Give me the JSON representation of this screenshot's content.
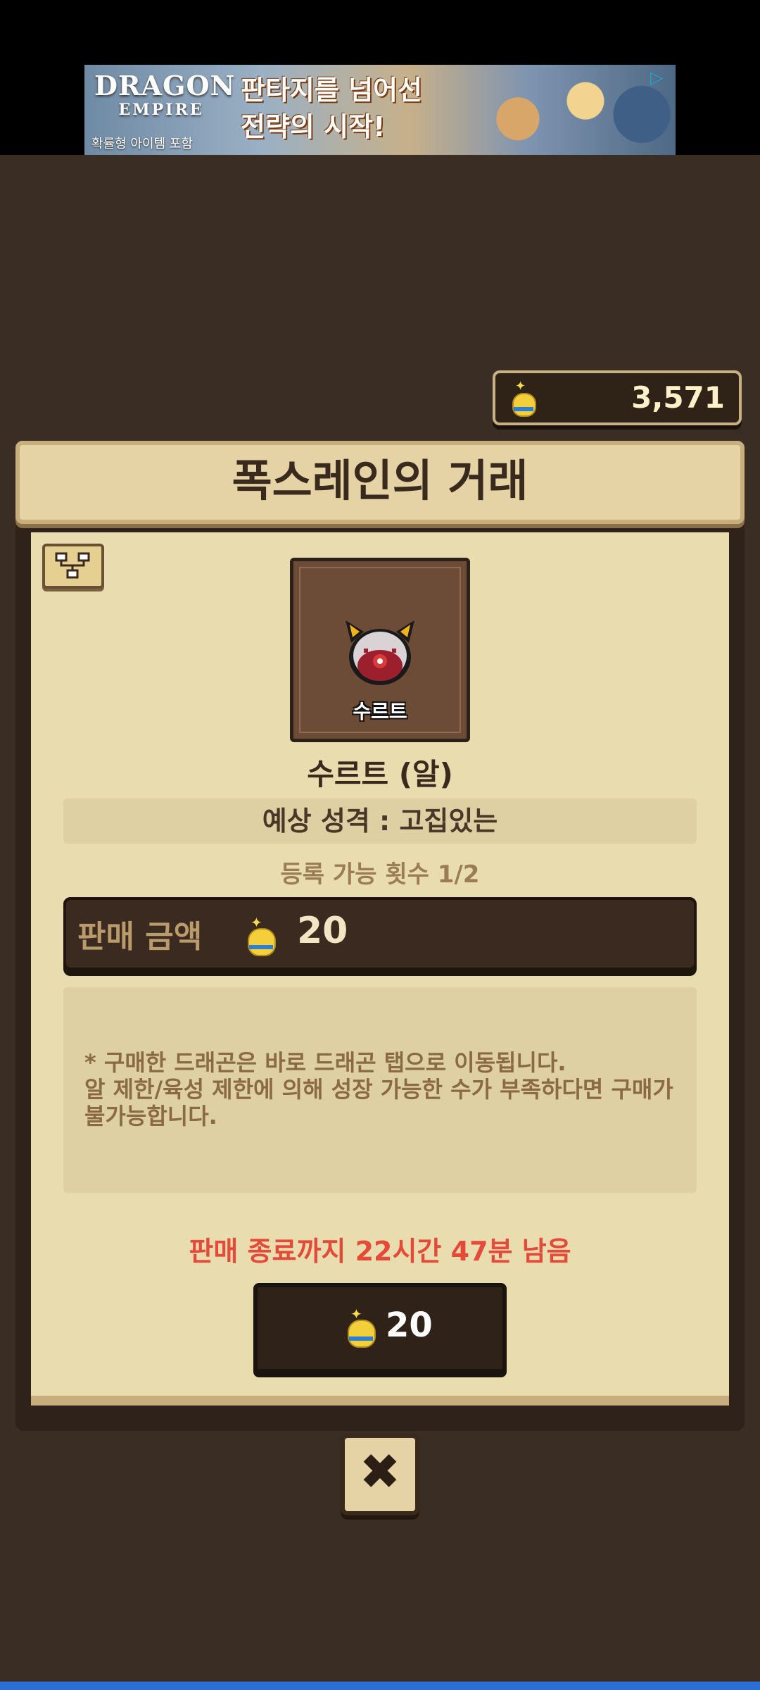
{
  "ad": {
    "brand_line1": "DRAGON",
    "brand_line2": "EMPIRE",
    "note": "확률형 아이템 포함",
    "slogan_line1": "판타지를 넘어선",
    "slogan_line2": "전략의 시작!"
  },
  "currency": {
    "icon": "gold-bag-icon",
    "amount": "3,571"
  },
  "header": {
    "title": "폭스레인의 거래"
  },
  "item": {
    "badge": "수르트",
    "title": "수르트 (알)",
    "trait": "예상 성격 : 고집있는",
    "register_count": "등록 가능 횟수 1/2"
  },
  "price": {
    "label": "판매 금액",
    "amount": "20"
  },
  "notice": {
    "text": "* 구매한 드래곤은 바로 드래곤 탭으로 이동됩니다.\n알 제한/육성 제한에 의해 성장 가능한 수가 부족하다면 구매가 불가능합니다."
  },
  "timer": {
    "text": "판매 종료까지 22시간 47분 남음"
  },
  "buy_button": {
    "amount": "20"
  },
  "colors": {
    "timer": "#e34a3a",
    "panel": "#e9dcae",
    "frame": "#2e221a"
  }
}
